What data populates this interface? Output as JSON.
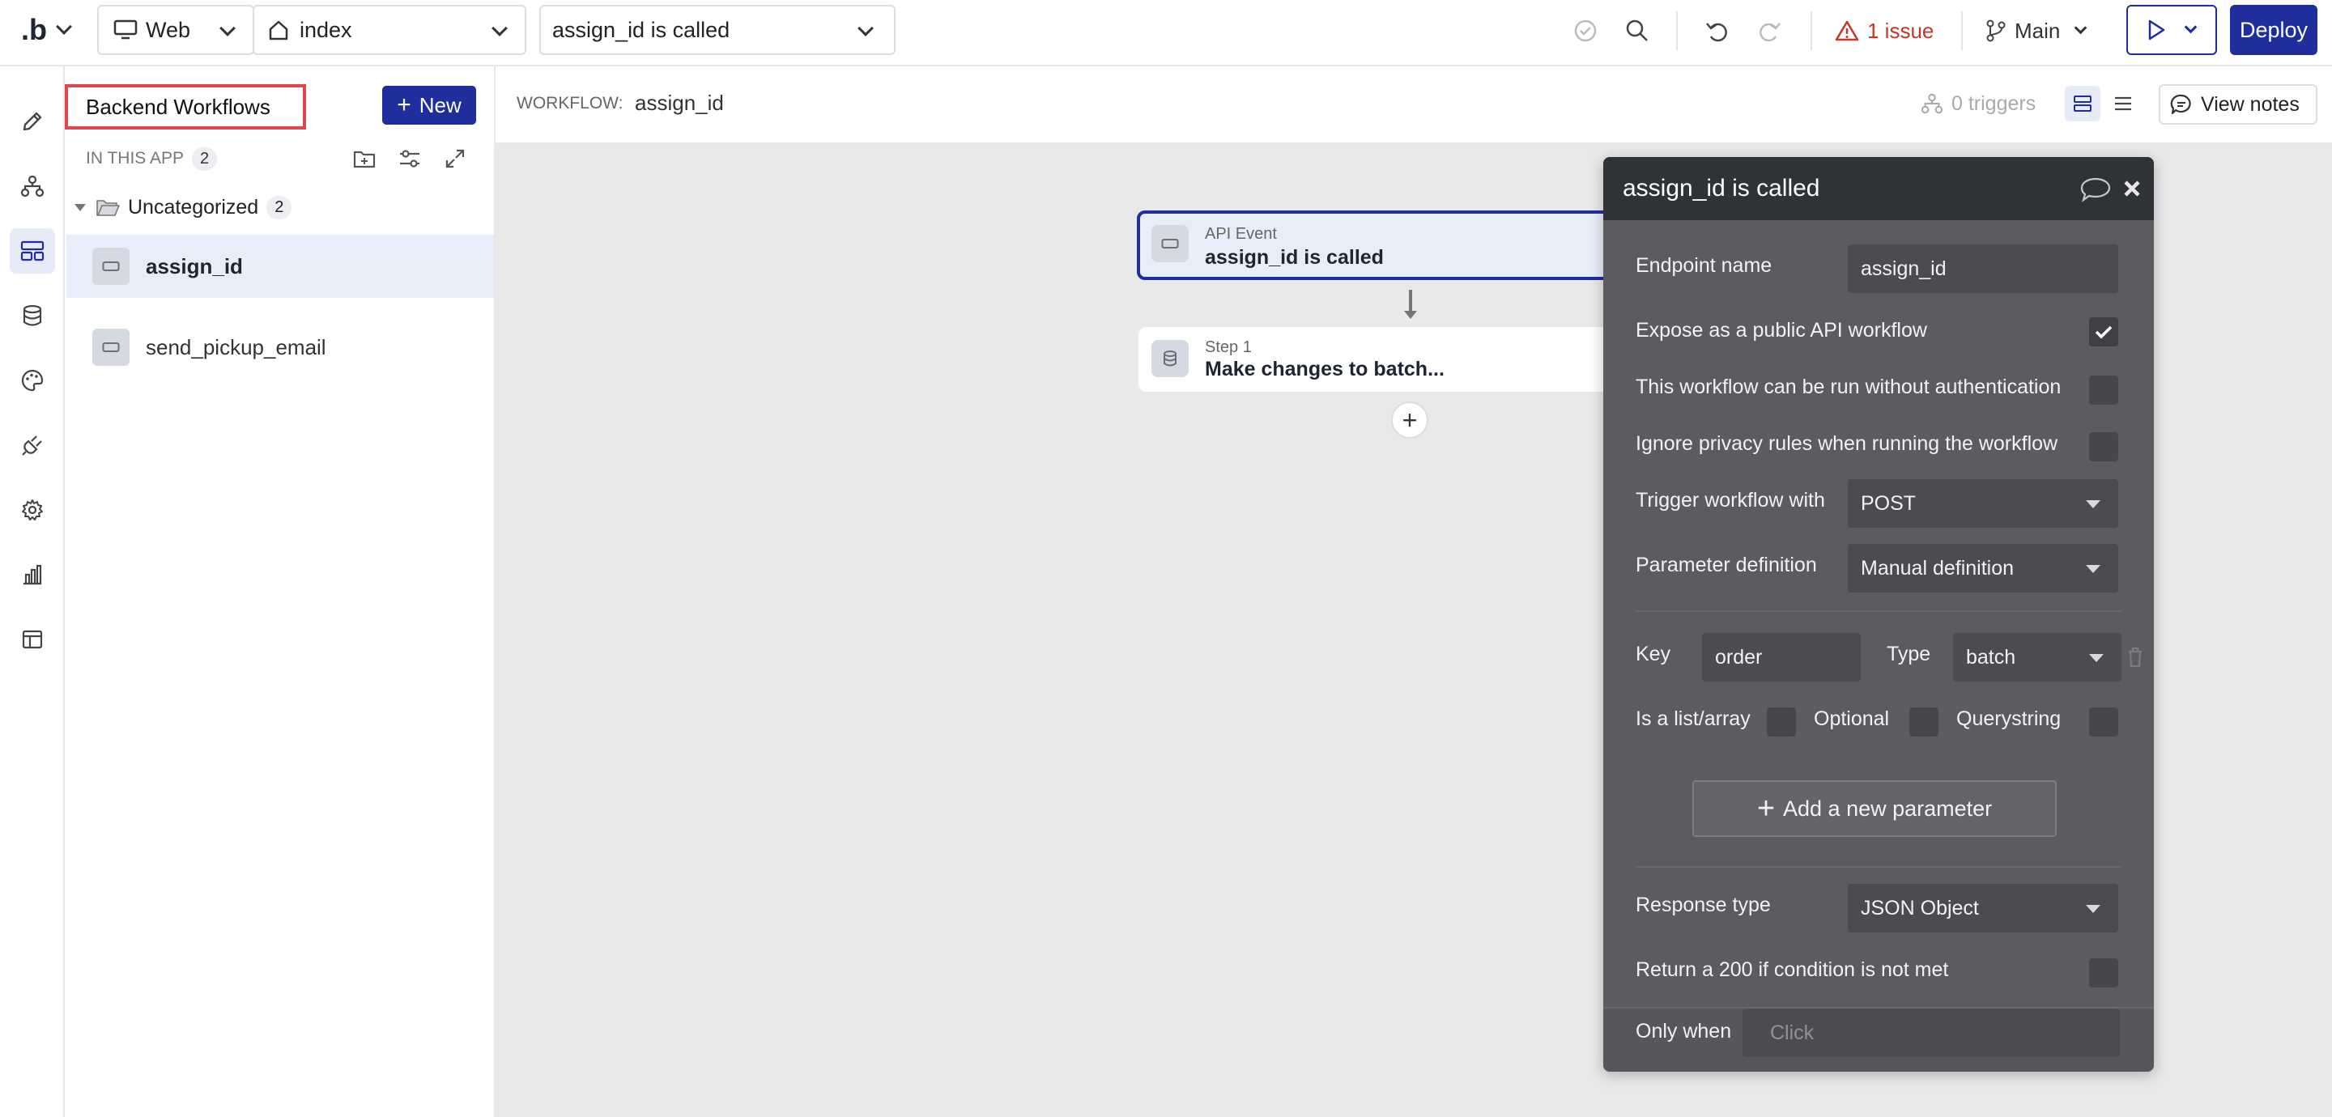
{
  "topbar": {
    "logo": ".b",
    "platform": "Web",
    "page": "index",
    "workflow_select": "assign_id is called",
    "issues": "1 issue",
    "branch": "Main",
    "deploy": "Deploy"
  },
  "panel": {
    "title": "Backend Workflows",
    "new_label": "New",
    "section_label": "IN THIS APP",
    "section_count": "2",
    "folder_name": "Uncategorized",
    "folder_count": "2",
    "items": [
      {
        "label": "assign_id"
      },
      {
        "label": "send_pickup_email"
      }
    ]
  },
  "workflow_bar": {
    "label": "WORKFLOW:",
    "name": "assign_id",
    "triggers": "0 triggers",
    "view_notes": "View notes"
  },
  "canvas": {
    "event_type": "API Event",
    "event_title": "assign_id is called",
    "step_label": "Step 1",
    "step_title": "Make changes to batch..."
  },
  "property_editor": {
    "title": "assign_id is called",
    "endpoint_label": "Endpoint name",
    "endpoint_value": "assign_id",
    "expose_label": "Expose as a public API workflow",
    "expose_checked": true,
    "noauth_label": "This workflow can be run without authentication",
    "noauth_checked": false,
    "privacy_label": "Ignore privacy rules when running the workflow",
    "privacy_checked": false,
    "trigger_label": "Trigger workflow with",
    "trigger_value": "POST",
    "paramdef_label": "Parameter definition",
    "paramdef_value": "Manual definition",
    "key_label": "Key",
    "key_value": "order",
    "type_label": "Type",
    "type_value": "batch",
    "list_label": "Is a list/array",
    "optional_label": "Optional",
    "querystring_label": "Querystring",
    "add_param_label": "Add a new parameter",
    "response_label": "Response type",
    "response_value": "JSON Object",
    "return200_label": "Return a 200 if condition is not met",
    "onlywhen_label": "Only when",
    "onlywhen_placeholder": "Click"
  },
  "colors": {
    "accent": "#1f2e9c",
    "issue_red": "#c0392b",
    "highlight_red": "#e0474c",
    "selected_row": "#e8eef9"
  }
}
